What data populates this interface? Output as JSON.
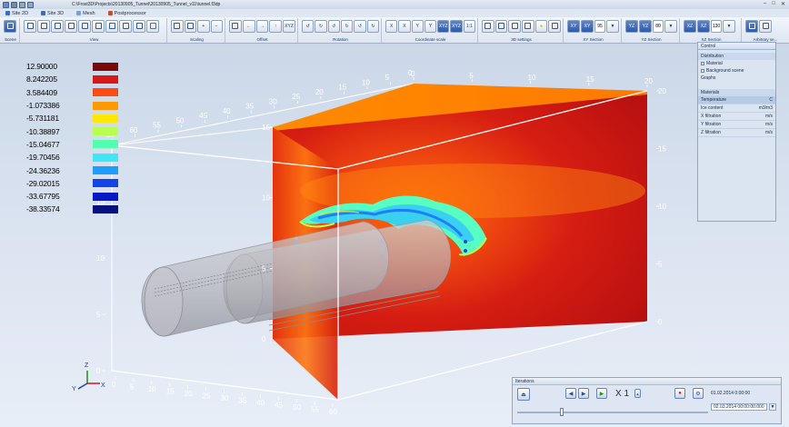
{
  "window": {
    "path": "C:\\Frost3D\\Projects\\20130905_Tunnel\\20130905_Tunnel_v11\\tunnel.f3dp"
  },
  "menu": [
    {
      "label": "Site 2D",
      "color": "#3a6ec4"
    },
    {
      "label": "Site 3D",
      "color": "#3a6ec4"
    },
    {
      "label": "Mesh",
      "color": "#7aa0d4"
    },
    {
      "label": "Postprocessor",
      "color": "#d04a2a"
    }
  ],
  "ribbon": {
    "groups": [
      "Scene",
      "View",
      "Scaling",
      "Offset",
      "Rotation",
      "Coordinate scale",
      "3D settings",
      "XY Section",
      "YZ Section",
      "XZ Section",
      "Arbitrary se..."
    ],
    "xy_value": "95",
    "yz_value": "80",
    "xz_value": "130"
  },
  "legend": [
    {
      "value": "12.90000",
      "color": "#7a0a0a"
    },
    {
      "value": "8.242205",
      "color": "#d81818"
    },
    {
      "value": "3.584409",
      "color": "#ff4a12"
    },
    {
      "value": "-1.073386",
      "color": "#ff9900"
    },
    {
      "value": "-5.731181",
      "color": "#ffe800"
    },
    {
      "value": "-10.38897",
      "color": "#b8ff50"
    },
    {
      "value": "-15.04677",
      "color": "#50ffb0"
    },
    {
      "value": "-19.70456",
      "color": "#3ee6f6"
    },
    {
      "value": "-24.36236",
      "color": "#1e9cff"
    },
    {
      "value": "-29.02015",
      "color": "#1244ea"
    },
    {
      "value": "-33.67795",
      "color": "#0818c4"
    },
    {
      "value": "-38.33574",
      "color": "#06107e"
    }
  ],
  "control": {
    "title": "Control",
    "distribution_label": "Distribution",
    "material_label": "Material",
    "background_label": "Background scene",
    "graphs_label": "Graphs",
    "materials_label": "Materials",
    "rows": [
      {
        "name": "Temperature",
        "unit": "C"
      },
      {
        "name": "Ice content",
        "unit": "m3/m3"
      },
      {
        "name": "X filtration",
        "unit": "m/s"
      },
      {
        "name": "Y filtration",
        "unit": "m/s"
      },
      {
        "name": "Z filtration",
        "unit": "m/s"
      }
    ]
  },
  "iterations": {
    "title": "Iterations",
    "speed": "X 1",
    "start_date": "01.02.2014 0:00:00",
    "current_date": "02.03.2014 00:00:00.000"
  },
  "axes": {
    "front_x": [
      "0",
      "5",
      "10",
      "15",
      "20",
      "25",
      "30",
      "35",
      "40",
      "45",
      "50",
      "55",
      "60"
    ],
    "back_top": [
      "0",
      "5",
      "10",
      "15",
      "20"
    ],
    "right_z": [
      "20",
      "15",
      "10",
      "5",
      "0"
    ],
    "back_left": [
      "15",
      "10",
      "5",
      "0"
    ],
    "top_left": [
      "65",
      "60",
      "55",
      "50",
      "45",
      "40",
      "35",
      "30",
      "25",
      "20",
      "15",
      "10",
      "5",
      "0"
    ],
    "left_vert": [
      "20",
      "15",
      "10",
      "5",
      "0"
    ]
  }
}
